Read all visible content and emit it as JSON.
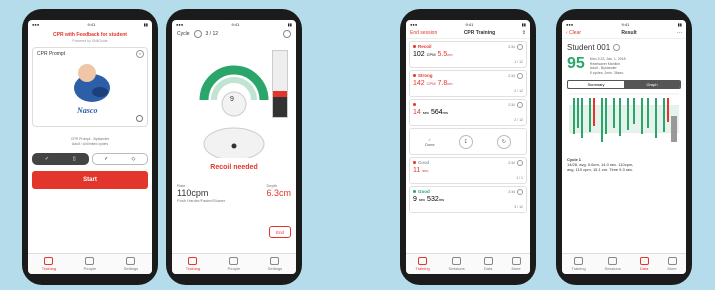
{
  "colors": {
    "accent": "#e2362c",
    "good": "#2aa66a",
    "background": "#b4dcea"
  },
  "tabs": [
    "Training",
    "People",
    "Settings"
  ],
  "tabs_p3": [
    "Training",
    "Sessions",
    "Data",
    "More"
  ],
  "phone1": {
    "header_line1": "CPR with Feedback for student",
    "header_line2": "Powered by SkillGuide",
    "card_label": "CPR Prompt",
    "brand": "Nasco",
    "desc_line1": "CPR Prompt - Bystander",
    "desc_line2": "Adult / Unlimited cycles",
    "start": "Start"
  },
  "phone2": {
    "cycle_label": "Cycle",
    "cycle_value": "3 / 12",
    "gauge_value": "9",
    "recoil": "Recoil needed",
    "rate_label": "Rate",
    "rate_value": "110cpm",
    "depth_label": "Depth",
    "depth_value": "6.3cm",
    "rate_note": "Push Harder/Faster/Slower",
    "end": "End"
  },
  "phone3": {
    "nav_left": "End session",
    "nav_title": "CPR Training",
    "rows": [
      {
        "title": "Recoil",
        "value": "102",
        "unit": "CPM",
        "value2": "5.5",
        "unit2": "cm",
        "page": "1 / 12",
        "meta": "2:34"
      },
      {
        "title": "Strong",
        "value": "142",
        "unit": "CPM",
        "value2": "7.8",
        "unit2": "cm",
        "page": "2 / 12",
        "meta": "2:34"
      },
      {
        "title": "",
        "value": "14",
        "unit": "sec",
        "value2": "564",
        "unit2": "ms",
        "page": "2 / 12",
        "meta": "2:34"
      },
      {
        "title": "Good",
        "value": "11",
        "unit": "sec",
        "value2": "",
        "unit2": "",
        "page": "1 / 1",
        "meta": "2:34"
      },
      {
        "title": "Good",
        "value": "9",
        "unit": "sec",
        "value2": "532",
        "unit2": "ms",
        "page": "3 / 12",
        "meta": "2:34"
      }
    ],
    "action_label": "Done"
  },
  "phone4": {
    "nav_left": "Clear",
    "nav_title": "Result",
    "student": "Student 001",
    "score": "95",
    "info": [
      "Mon 2:22, Jan. 1, 2018",
      "Heartsaver Manikin",
      "Adult - Bystander",
      "5 cycles, 2min. 36sec."
    ],
    "seg": [
      "Summary",
      "Graph"
    ],
    "cycle_title": "Cycle 1",
    "cycle_line1": "14/28, avg. 5.6cm, 14.0 sec. 110cpm,",
    "cycle_line2": "avg. 110 cpm, 15.1 cm. Time 9.3 sec."
  }
}
